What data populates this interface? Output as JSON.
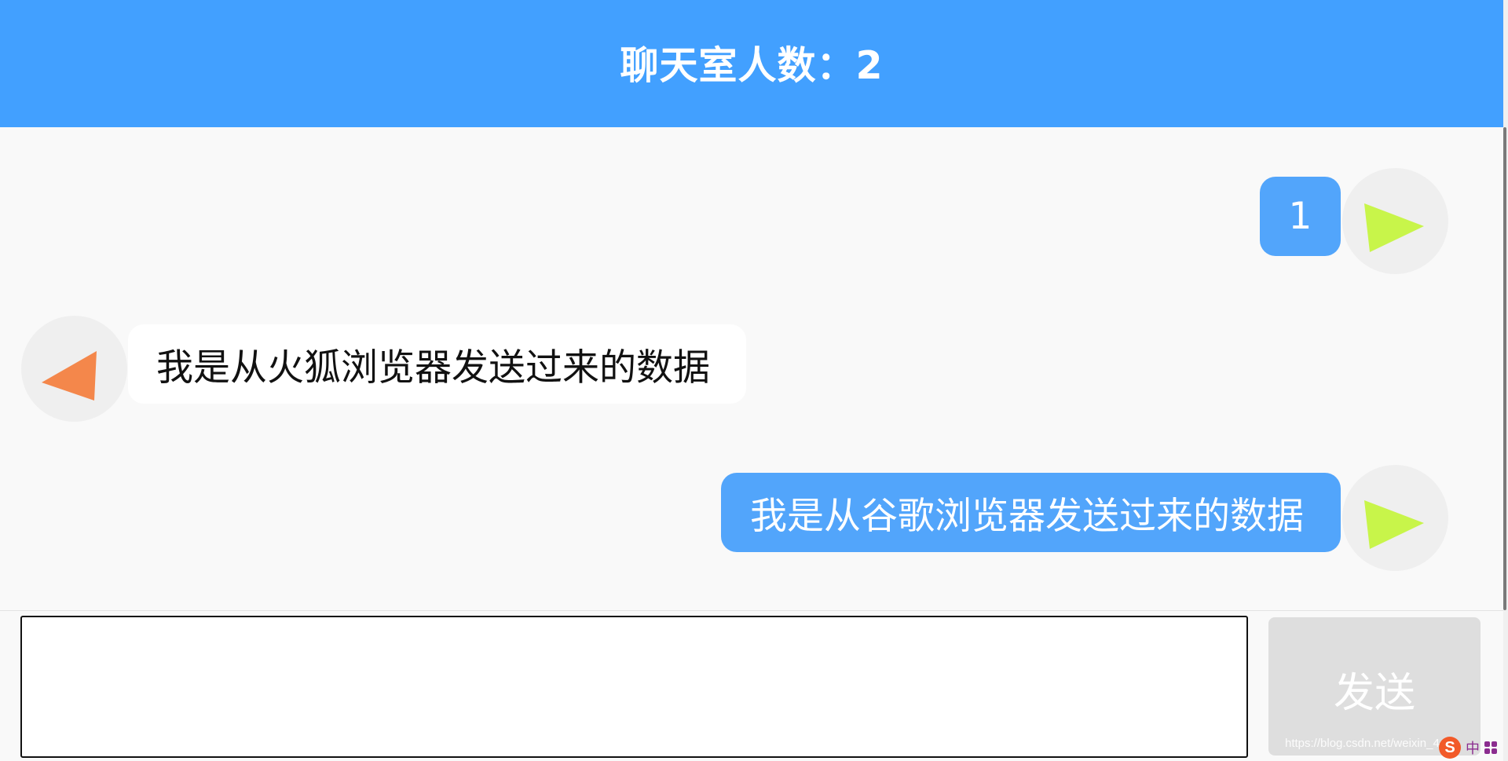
{
  "header": {
    "title": "聊天室人数：2"
  },
  "messages": [
    {
      "sender": "self",
      "text": "1",
      "avatar_icon": "play-arrow-right-icon",
      "avatar_color": "#c8f54a"
    },
    {
      "sender": "other",
      "text": "我是从火狐浏览器发送过来的数据",
      "avatar_icon": "play-arrow-left-icon",
      "avatar_color": "#f4874b"
    },
    {
      "sender": "self",
      "text": "我是从谷歌浏览器发送过来的数据",
      "avatar_icon": "play-arrow-right-icon",
      "avatar_color": "#c8f54a"
    }
  ],
  "composer": {
    "input_value": "",
    "send_label": "发送"
  },
  "watermark": "https://blog.csdn.net/weixin_4",
  "ime": {
    "logo": "S",
    "lang": "中",
    "menu_icon": "grid-icon"
  },
  "colors": {
    "header_bg": "#42a0ff",
    "self_bubble": "#52a5fb",
    "other_bubble": "#ffffff",
    "send_button_bg": "#dedede"
  }
}
